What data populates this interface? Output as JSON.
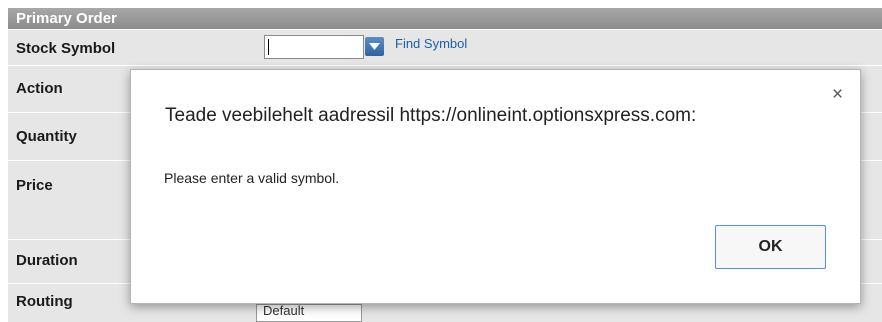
{
  "section": {
    "title": "Primary Order"
  },
  "rows": {
    "stock_symbol": "Stock Symbol",
    "action": "Action",
    "quantity": "Quantity",
    "price": "Price",
    "duration": "Duration",
    "routing": "Routing"
  },
  "symbol": {
    "value": "",
    "find_link": "Find Symbol"
  },
  "routing_select": {
    "value": "Default"
  },
  "dialog": {
    "title": "Teade veebilehelt aadressil https://onlineint.optionsxpress.com:",
    "close_glyph": "×",
    "message": "Please enter a valid symbol.",
    "ok_label": "OK"
  },
  "colors": {
    "header_bg": "#999999",
    "row_bg": "#e6e6e6",
    "link": "#1d5fa8",
    "ok_border": "#4d90fe"
  },
  "icons": {
    "dropdown": "chevron-down-icon"
  }
}
